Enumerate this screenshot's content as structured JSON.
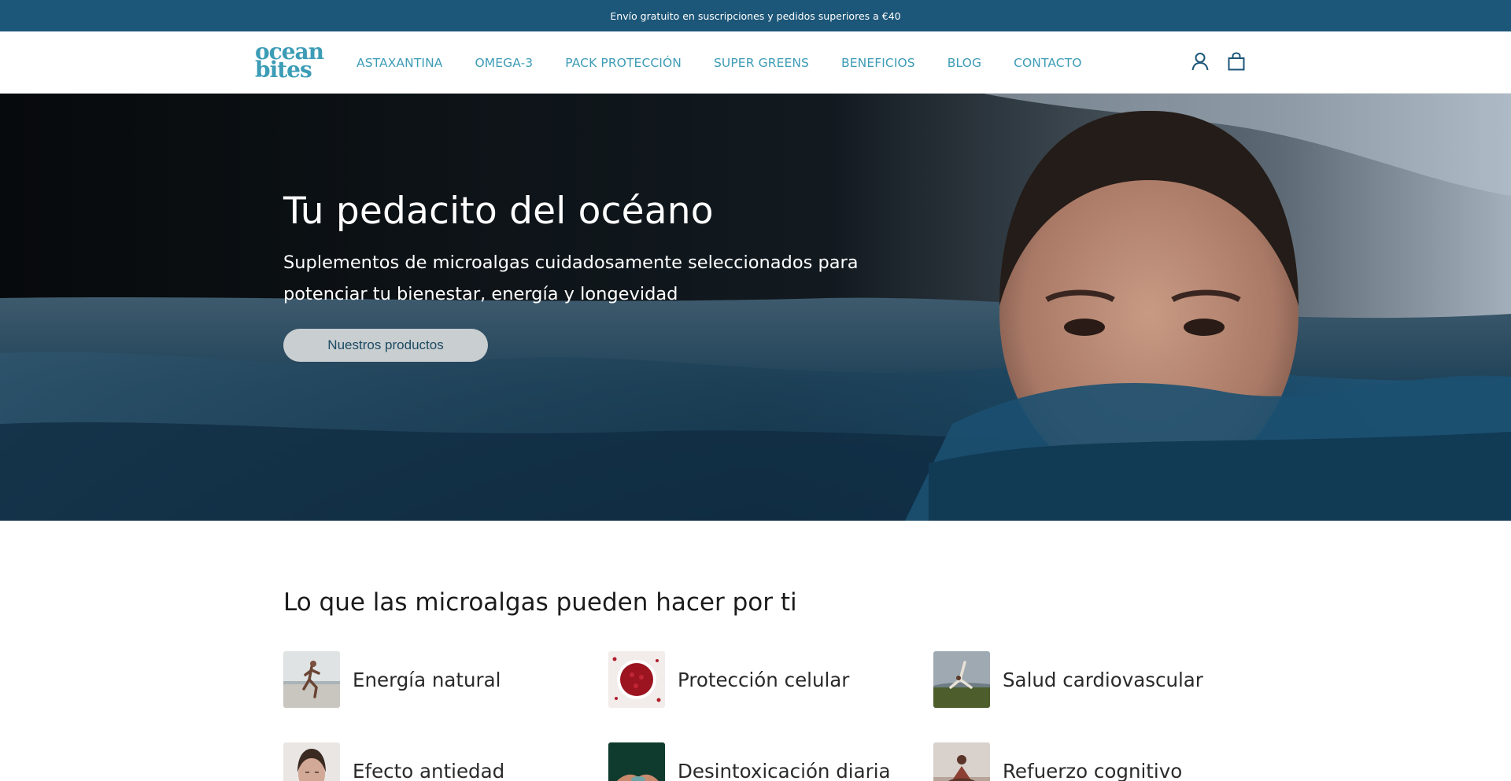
{
  "announcement": {
    "text": "Envío gratuito en suscripciones y pedidos superiores a €40"
  },
  "brand": {
    "line1": "ocean",
    "line2": "bites",
    "color": "#3d9cb6"
  },
  "nav": {
    "items": [
      {
        "label": "ASTAXANTINA"
      },
      {
        "label": "OMEGA-3"
      },
      {
        "label": "PACK PROTECCIÓN"
      },
      {
        "label": "SUPER GREENS"
      },
      {
        "label": "BENEFICIOS"
      },
      {
        "label": "BLOG"
      },
      {
        "label": "CONTACTO"
      }
    ],
    "account_icon": "user-icon",
    "cart_icon": "shopping-bag-icon"
  },
  "hero": {
    "title": "Tu pedacito del océano",
    "subtitle": "Suplementos de microalgas cuidadosamente seleccionados para potenciar tu bienestar, energía y longevidad",
    "cta_label": "Nuestros productos"
  },
  "benefits": {
    "title": "Lo que las microalgas pueden hacer por ti",
    "items": [
      {
        "label": "Energía natural",
        "image": "runner-on-beach"
      },
      {
        "label": "Protección celular",
        "image": "red-algae-bowl"
      },
      {
        "label": "Salud cardiovascular",
        "image": "yoga-on-grass"
      },
      {
        "label": "Efecto antiedad",
        "image": "woman-face-portrait"
      },
      {
        "label": "Desintoxicación diaria",
        "image": "hands-holding-water"
      },
      {
        "label": "Refuerzo cognitivo",
        "image": "meditation-seaside"
      }
    ]
  },
  "colors": {
    "announcement_bg": "#1c5678",
    "accent": "#3d9cb6",
    "cta_bg": "#c9ced1",
    "cta_text": "#1c4a62"
  }
}
